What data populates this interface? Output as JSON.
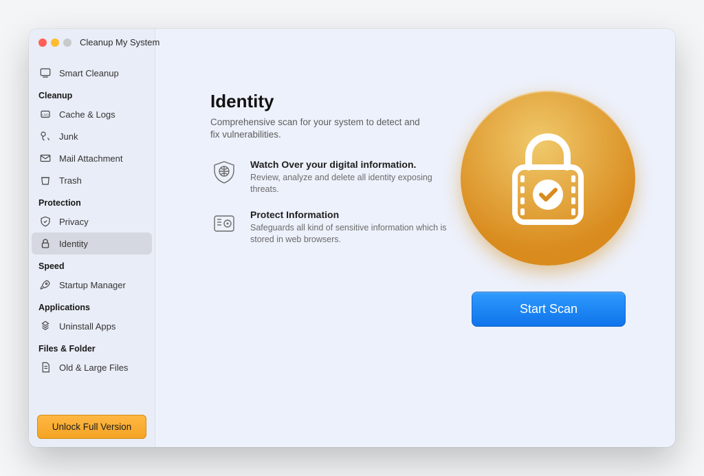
{
  "app_title": "Cleanup My System",
  "sidebar": {
    "top_item": {
      "label": "Smart Cleanup",
      "icon": "monitor-icon"
    },
    "sections": [
      {
        "title": "Cleanup",
        "items": [
          {
            "label": "Cache & Logs",
            "icon": "log-icon"
          },
          {
            "label": "Junk",
            "icon": "footprint-icon"
          },
          {
            "label": "Mail Attachment",
            "icon": "mail-icon"
          },
          {
            "label": "Trash",
            "icon": "trash-icon"
          }
        ]
      },
      {
        "title": "Protection",
        "items": [
          {
            "label": "Privacy",
            "icon": "shield-check-icon"
          },
          {
            "label": "Identity",
            "icon": "lock-icon",
            "selected": true
          }
        ]
      },
      {
        "title": "Speed",
        "items": [
          {
            "label": "Startup Manager",
            "icon": "rocket-icon"
          }
        ]
      },
      {
        "title": "Applications",
        "items": [
          {
            "label": "Uninstall Apps",
            "icon": "app-icon"
          }
        ]
      },
      {
        "title": "Files & Folder",
        "items": [
          {
            "label": "Old & Large Files",
            "icon": "file-icon"
          }
        ]
      }
    ],
    "unlock_label": "Unlock Full Version"
  },
  "page": {
    "title": "Identity",
    "subtitle": "Comprehensive scan for your system to detect and fix vulnerabilities.",
    "features": [
      {
        "title": "Watch Over your digital information.",
        "desc": "Review, analyze and delete all identity exposing threats."
      },
      {
        "title": "Protect Information",
        "desc": "Safeguards all kind of sensitive information which is stored in web browsers."
      }
    ],
    "scan_button": "Start Scan"
  },
  "colors": {
    "accent_orange": "#f4a424",
    "accent_blue": "#1a7ff0",
    "hero_gradient_from": "#f0c96b",
    "hero_gradient_to": "#d98b1e"
  }
}
